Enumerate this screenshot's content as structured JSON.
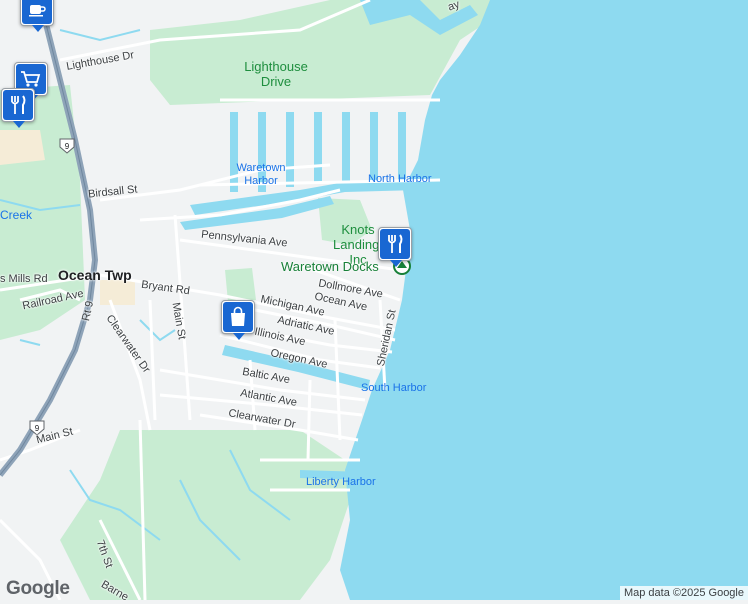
{
  "colors": {
    "water": "#8edaf0",
    "land": "#f1f3f4",
    "park": "#c8ecd2",
    "highway": "#8ea3b8",
    "marker": "#1967d2"
  },
  "labels": {
    "lighthouse_dr": "Lighthouse Dr",
    "lighthouse_drive_park": "Lighthouse Drive",
    "waretown_harbor": "Waretown Harbor",
    "north_harbor": "North Harbor",
    "birdsall_st": "Birdsall St",
    "creek": "Creek",
    "knots_landing": "Knots Landing, Inc",
    "pennsylvania_ave": "Pennsylvania Ave",
    "waretown_docks": "Waretown Docks",
    "dollmore_ave": "Dollmore Ave",
    "ocean_ave": "Ocean Ave",
    "michigan_ave": "Michigan Ave",
    "adriatic_ave": "Adriatic Ave",
    "illinois_ave": "Illinois Ave",
    "oregon_ave": "Oregon Ave",
    "sheridan_st": "Sheridan St",
    "south_harbor": "South Harbor",
    "baltic_ave": "Baltic Ave",
    "atlantic_ave": "Atlantic Ave",
    "clearwater_dr_east": "Clearwater Dr",
    "clearwater_dr_west": "Clearwater Dr",
    "ocean_twp": "Ocean Twp",
    "mills_rd": "s Mills Rd",
    "bryant_rd": "Bryant Rd",
    "main_st_north": "Main St",
    "main_st_south": "Main St",
    "railroad_ave": "Railroad Ave",
    "rt9": "Rt 9",
    "liberty_harbor": "Liberty Harbor",
    "seventh_st": "7th St",
    "barnegat": "Barne",
    "bay": "ay",
    "route_shield": "9"
  },
  "markers": [
    {
      "name": "cafe-marker",
      "icon": "coffee-cup-icon"
    },
    {
      "name": "grocery-marker",
      "icon": "shopping-cart-icon"
    },
    {
      "name": "restaurant-marker-west",
      "icon": "fork-knife-icon"
    },
    {
      "name": "restaurant-marker-docks",
      "icon": "fork-knife-icon"
    },
    {
      "name": "shopping-marker",
      "icon": "shopping-bag-icon"
    }
  ],
  "footer": {
    "logo": "Google",
    "attribution": "Map data ©2025 Google"
  }
}
